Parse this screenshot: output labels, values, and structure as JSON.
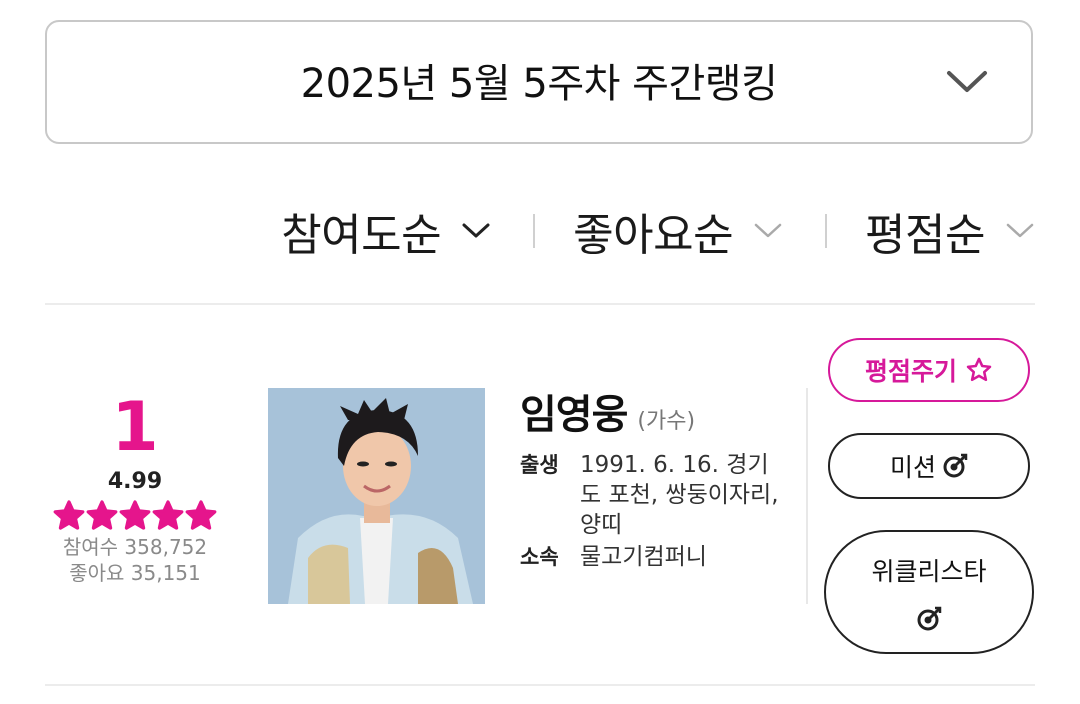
{
  "week_selector": {
    "label": "2025년 5월 5주차 주간랭킹",
    "icon": "chevron-down-icon"
  },
  "sort_options": [
    {
      "label": "참여도순",
      "active": true
    },
    {
      "label": "좋아요순",
      "active": false
    },
    {
      "label": "평점순",
      "active": false
    }
  ],
  "colors": {
    "accent": "#e5158c",
    "rate_button": "#d6199a",
    "stat_text": "#8a8a8a",
    "divider": "#ececec"
  },
  "entry": {
    "rank": "1",
    "score": "4.99",
    "stars": 5,
    "participants": "참여수 358,752",
    "likes": "좋아요 35,151",
    "name": "임영웅",
    "job": "(가수)",
    "birth_key": "출생",
    "birth_value": "1991. 6. 16. 경기도 포천, 쌍둥이자리, 양띠",
    "agency_key": "소속",
    "agency_value": "물고기컴퍼니"
  },
  "buttons": {
    "rate": "평점주기",
    "rate_icon": "star-outline-icon",
    "mission": "미션",
    "mission_icon": "target-icon",
    "weekly_star": "위클리스타",
    "weekly_icon": "target-icon"
  }
}
